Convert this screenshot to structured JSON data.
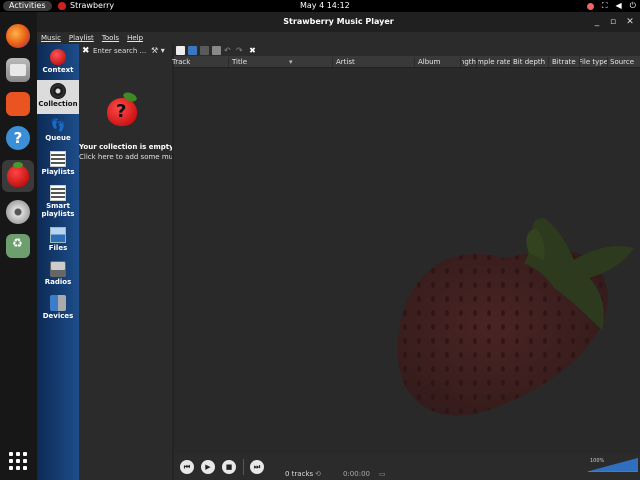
{
  "topbar": {
    "activities": "Activities",
    "app_name": "Strawberry",
    "clock": "May 4  14:12",
    "tray_network": "⛶",
    "tray_sound": "◀",
    "tray_power": "⏻"
  },
  "dock": {
    "help_glyph": "?"
  },
  "window": {
    "title": "Strawberry Music Player",
    "min_glyph": "_",
    "max_glyph": "▫",
    "close_glyph": "✕"
  },
  "menu": [
    "Music",
    "Playlist",
    "Tools",
    "Help"
  ],
  "sidebar": {
    "tabs": [
      "Context",
      "Collection",
      "Queue",
      "Playlists",
      "Smart playlists",
      "Files",
      "Radios",
      "Devices"
    ],
    "active": "Collection"
  },
  "collection": {
    "search_clear": "✖",
    "search_placeholder": "Enter search ...",
    "options_glyph": "⚒ ▾",
    "empty_berry_glyph": "?",
    "empty_title": "Your collection is empty!",
    "empty_link": "Click here to add some music"
  },
  "toolbar": {
    "undo_glyph": "↶",
    "redo_glyph": "↷",
    "clear_glyph": "✖"
  },
  "playlist": {
    "columns": [
      "Track",
      "Title",
      "Artist",
      "Album",
      "Length",
      "Sample rate",
      "Bit depth",
      "Bitrate",
      "File type",
      "Source"
    ],
    "sort_indicator": "▾"
  },
  "transport": {
    "prev_glyph": "⏮",
    "play_glyph": "▶",
    "stop_glyph": "■",
    "next_glyph": "⏭",
    "volume_label": "100%"
  },
  "status": {
    "tracks": "0 tracks",
    "icon": "⟲",
    "time": "0:00:00",
    "icon2": "▭"
  }
}
